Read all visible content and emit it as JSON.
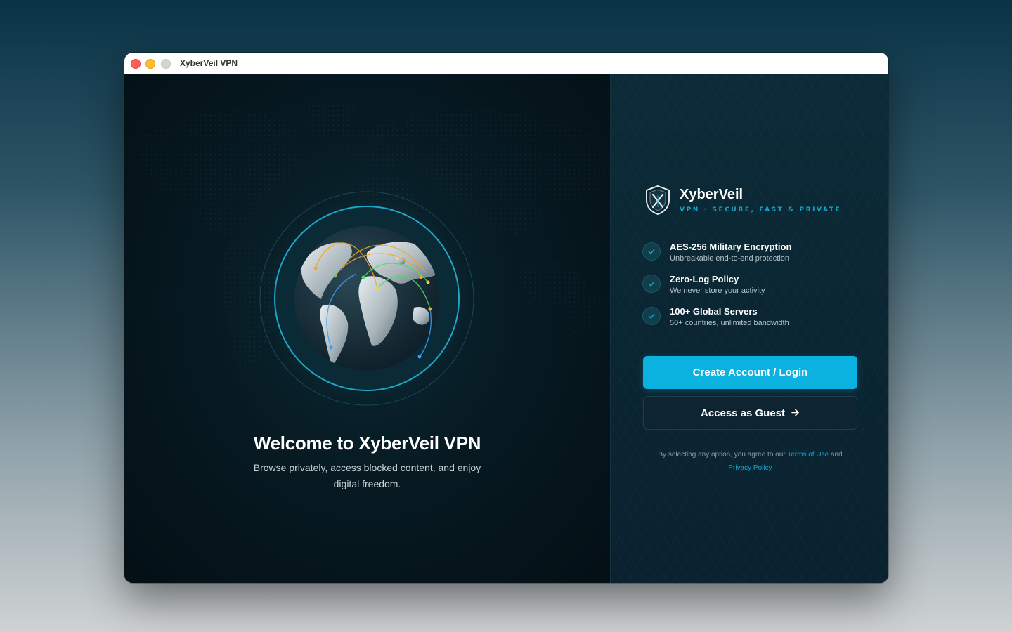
{
  "window": {
    "title": "XyberVeil VPN"
  },
  "welcome": {
    "title": "Welcome to XyberVeil VPN",
    "subtitle": "Browse privately, access blocked content, and enjoy digital freedom."
  },
  "brand": {
    "name": "XyberVeil",
    "tagline": "VPN · SECURE, FAST & PRIVATE",
    "accent": "#1aa4c8"
  },
  "features": [
    {
      "icon": "check-icon",
      "title": "AES-256 Military Encryption",
      "description": "Unbreakable end-to-end protection"
    },
    {
      "icon": "check-icon",
      "title": "Zero-Log Policy",
      "description": "We never store your activity"
    },
    {
      "icon": "check-icon",
      "title": "100+ Global Servers",
      "description": "50+ countries, unlimited bandwidth"
    }
  ],
  "actions": {
    "primary_label": "Create Account / Login",
    "primary_color": "#0bb2e0",
    "secondary_label": "Access as Guest",
    "secondary_icon": "arrow-right-icon"
  },
  "legal": {
    "prefix": "By selecting any option, you agree to our",
    "terms_link": "Terms of Use",
    "conjunction": "and",
    "privacy_link": "Privacy Policy"
  }
}
